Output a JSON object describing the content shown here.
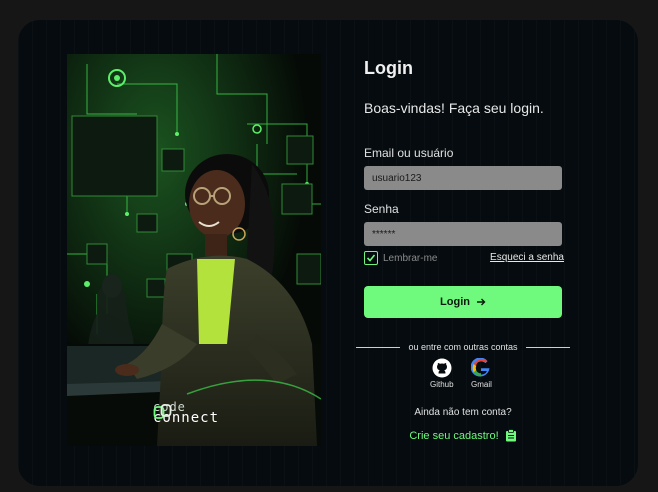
{
  "hero": {
    "brand_line1": "code",
    "brand_line2": "connect"
  },
  "form": {
    "title": "Login",
    "subtitle": "Boas-vindas! Faça seu login.",
    "email_label": "Email ou usuário",
    "email_value": "usuario123",
    "password_label": "Senha",
    "password_value": "******",
    "remember_label": "Lembrar-me",
    "remember_checked": true,
    "forgot_label": "Esqueci a senha",
    "login_button": "Login",
    "divider_text": "ou entre com outras contas",
    "social": [
      {
        "label": "Github",
        "icon": "github-icon"
      },
      {
        "label": "Gmail",
        "icon": "google-icon"
      }
    ],
    "no_account_text": "Ainda não tem conta?",
    "signup_link": "Crie seu cadastro!"
  },
  "colors": {
    "accent": "#6ffa7d",
    "background": "#050b0e",
    "input_bg": "#8a8a8a"
  }
}
